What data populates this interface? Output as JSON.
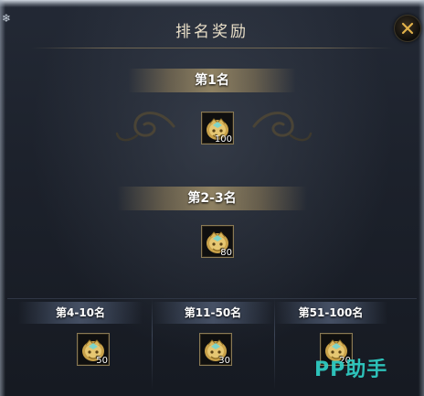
{
  "dialog": {
    "title": "排名奖励",
    "close_icon": "close-x-icon"
  },
  "tiers": [
    {
      "label": "第1名",
      "reward_icon": "golden-beast-token-icon",
      "count": "100"
    },
    {
      "label": "第2-3名",
      "reward_icon": "golden-beast-token-icon",
      "count": "80"
    },
    {
      "label": "第4-10名",
      "reward_icon": "golden-beast-token-icon",
      "count": "50"
    },
    {
      "label": "第11-50名",
      "reward_icon": "golden-beast-token-icon",
      "count": "30"
    },
    {
      "label": "第51-100名",
      "reward_icon": "golden-beast-token-icon",
      "count": "20"
    }
  ],
  "watermark": "PP助手",
  "colors": {
    "title_text": "#e9dfc8",
    "gold_banner": "#af9b6e",
    "item_border": "#8a7a55",
    "watermark": "#2fd0c6",
    "close_x": "#e2b24a"
  }
}
